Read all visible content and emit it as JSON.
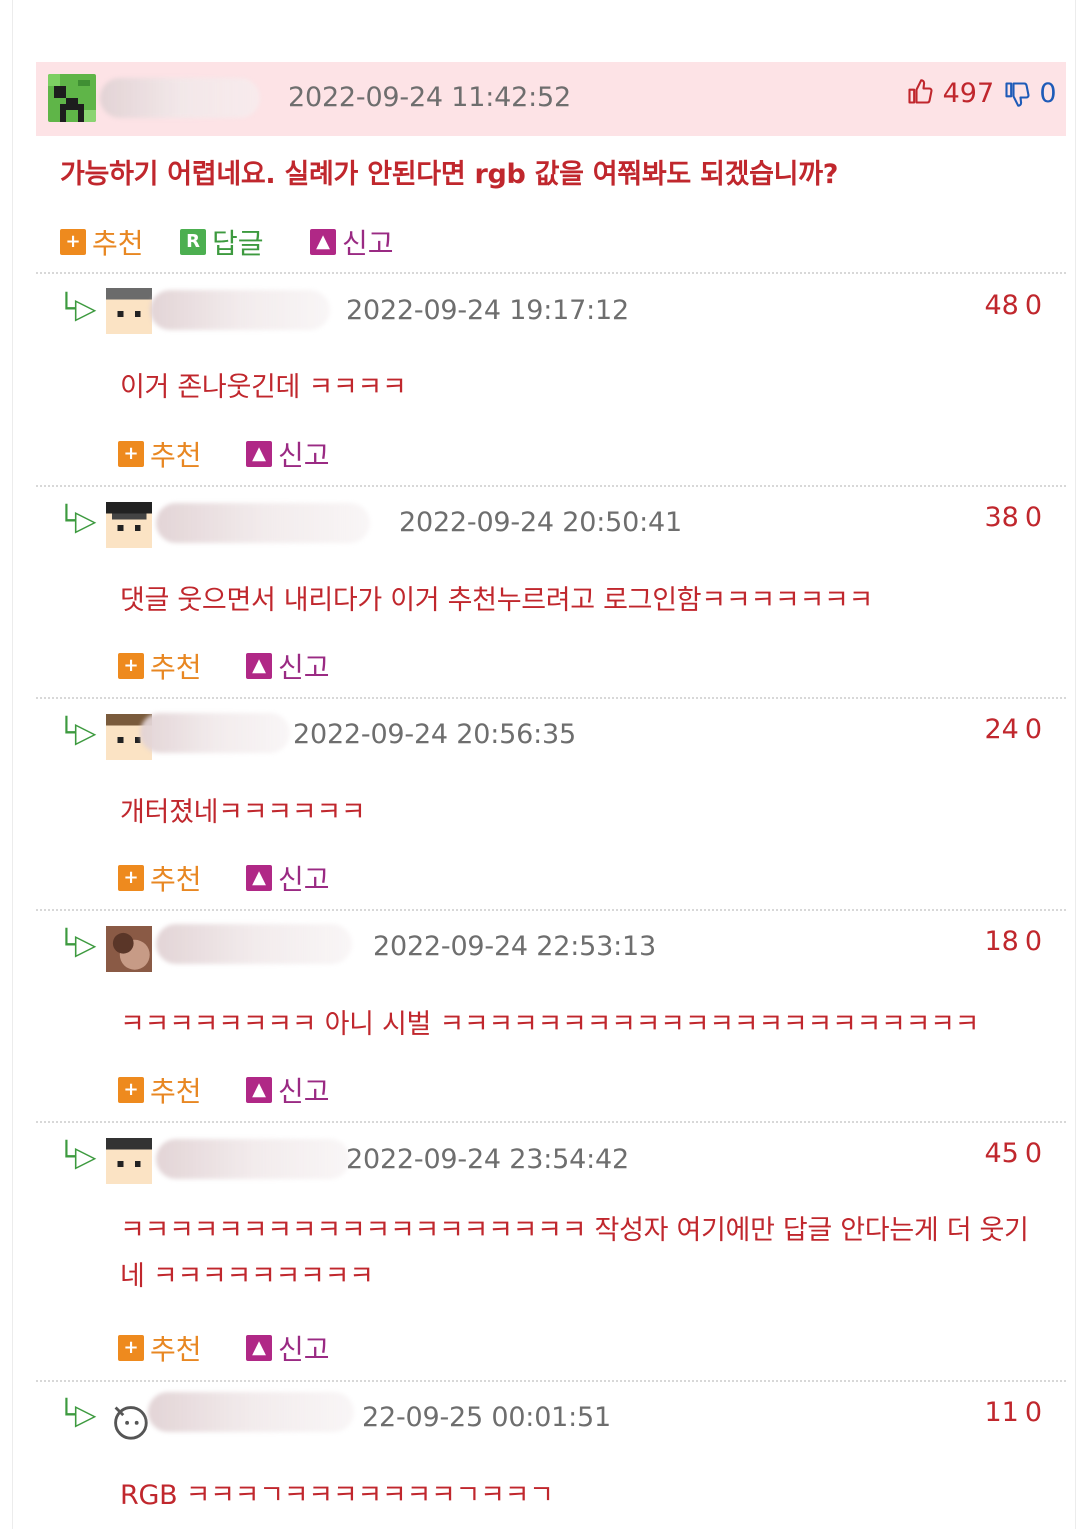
{
  "top_comment": {
    "timestamp": "2022-09-24 11:42:52",
    "upvotes": "497",
    "downvotes": "0",
    "text": "가능하기 어렵네요. 실례가 안된다면 rgb 값을 여쭤봐도 되겠습니까?",
    "actions": {
      "recommend": "추천",
      "reply": "답글",
      "report": "신고"
    },
    "icons": {
      "recommend": "plus-icon",
      "reply": "reply-r-icon",
      "report": "siren-icon",
      "up": "thumbs-up-icon",
      "down": "thumbs-down-icon"
    }
  },
  "reply_marker": "└▷",
  "replies": [
    {
      "timestamp": "2022-09-24 19:17:12",
      "score": "48",
      "down": "0",
      "text": "이거 존나웃긴데 ㅋㅋㅋㅋ",
      "recommend": "추천",
      "report": "신고"
    },
    {
      "timestamp": "2022-09-24 20:50:41",
      "score": "38",
      "down": "0",
      "text": "댓글 웃으면서 내리다가 이거 추천누르려고 로그인함ㅋㅋㅋㅋㅋㅋㅋ",
      "recommend": "추천",
      "report": "신고"
    },
    {
      "timestamp": "2022-09-24 20:56:35",
      "score": "24",
      "down": "0",
      "text": "개터졌네ㅋㅋㅋㅋㅋㅋ",
      "recommend": "추천",
      "report": "신고"
    },
    {
      "timestamp": "2022-09-24 22:53:13",
      "score": "18",
      "down": "0",
      "text": "ㅋㅋㅋㅋㅋㅋㅋㅋ 아니 시벌 ㅋㅋㅋㅋㅋㅋㅋㅋㅋㅋㅋㅋㅋㅋㅋㅋㅋㅋㅋㅋㅋㅋ",
      "recommend": "추천",
      "report": "신고"
    },
    {
      "timestamp": "2022-09-24 23:54:42",
      "score": "45",
      "down": "0",
      "text": "ㅋㅋㅋㅋㅋㅋㅋㅋㅋㅋㅋㅋㅋㅋㅋㅋㅋㅋㅋ 작성자 여기에만 답글 안다는게 더 웃기네 ㅋㅋㅋㅋㅋㅋㅋㅋㅋ",
      "recommend": "추천",
      "report": "신고"
    },
    {
      "timestamp": "22-09-25 00:01:51",
      "score": "11",
      "down": "0",
      "text": "RGB ㅋㅋㅋㄱㅋㅋㅋㅋㅋㅋㅋㄱㅋㅋㄱ"
    }
  ],
  "colors": {
    "accent_red": "#c0272d",
    "header_bg": "#fde3e6",
    "reply_green": "#3d9a3f",
    "recommend_orange": "#ee8a1e",
    "report_purple": "#b02886"
  }
}
